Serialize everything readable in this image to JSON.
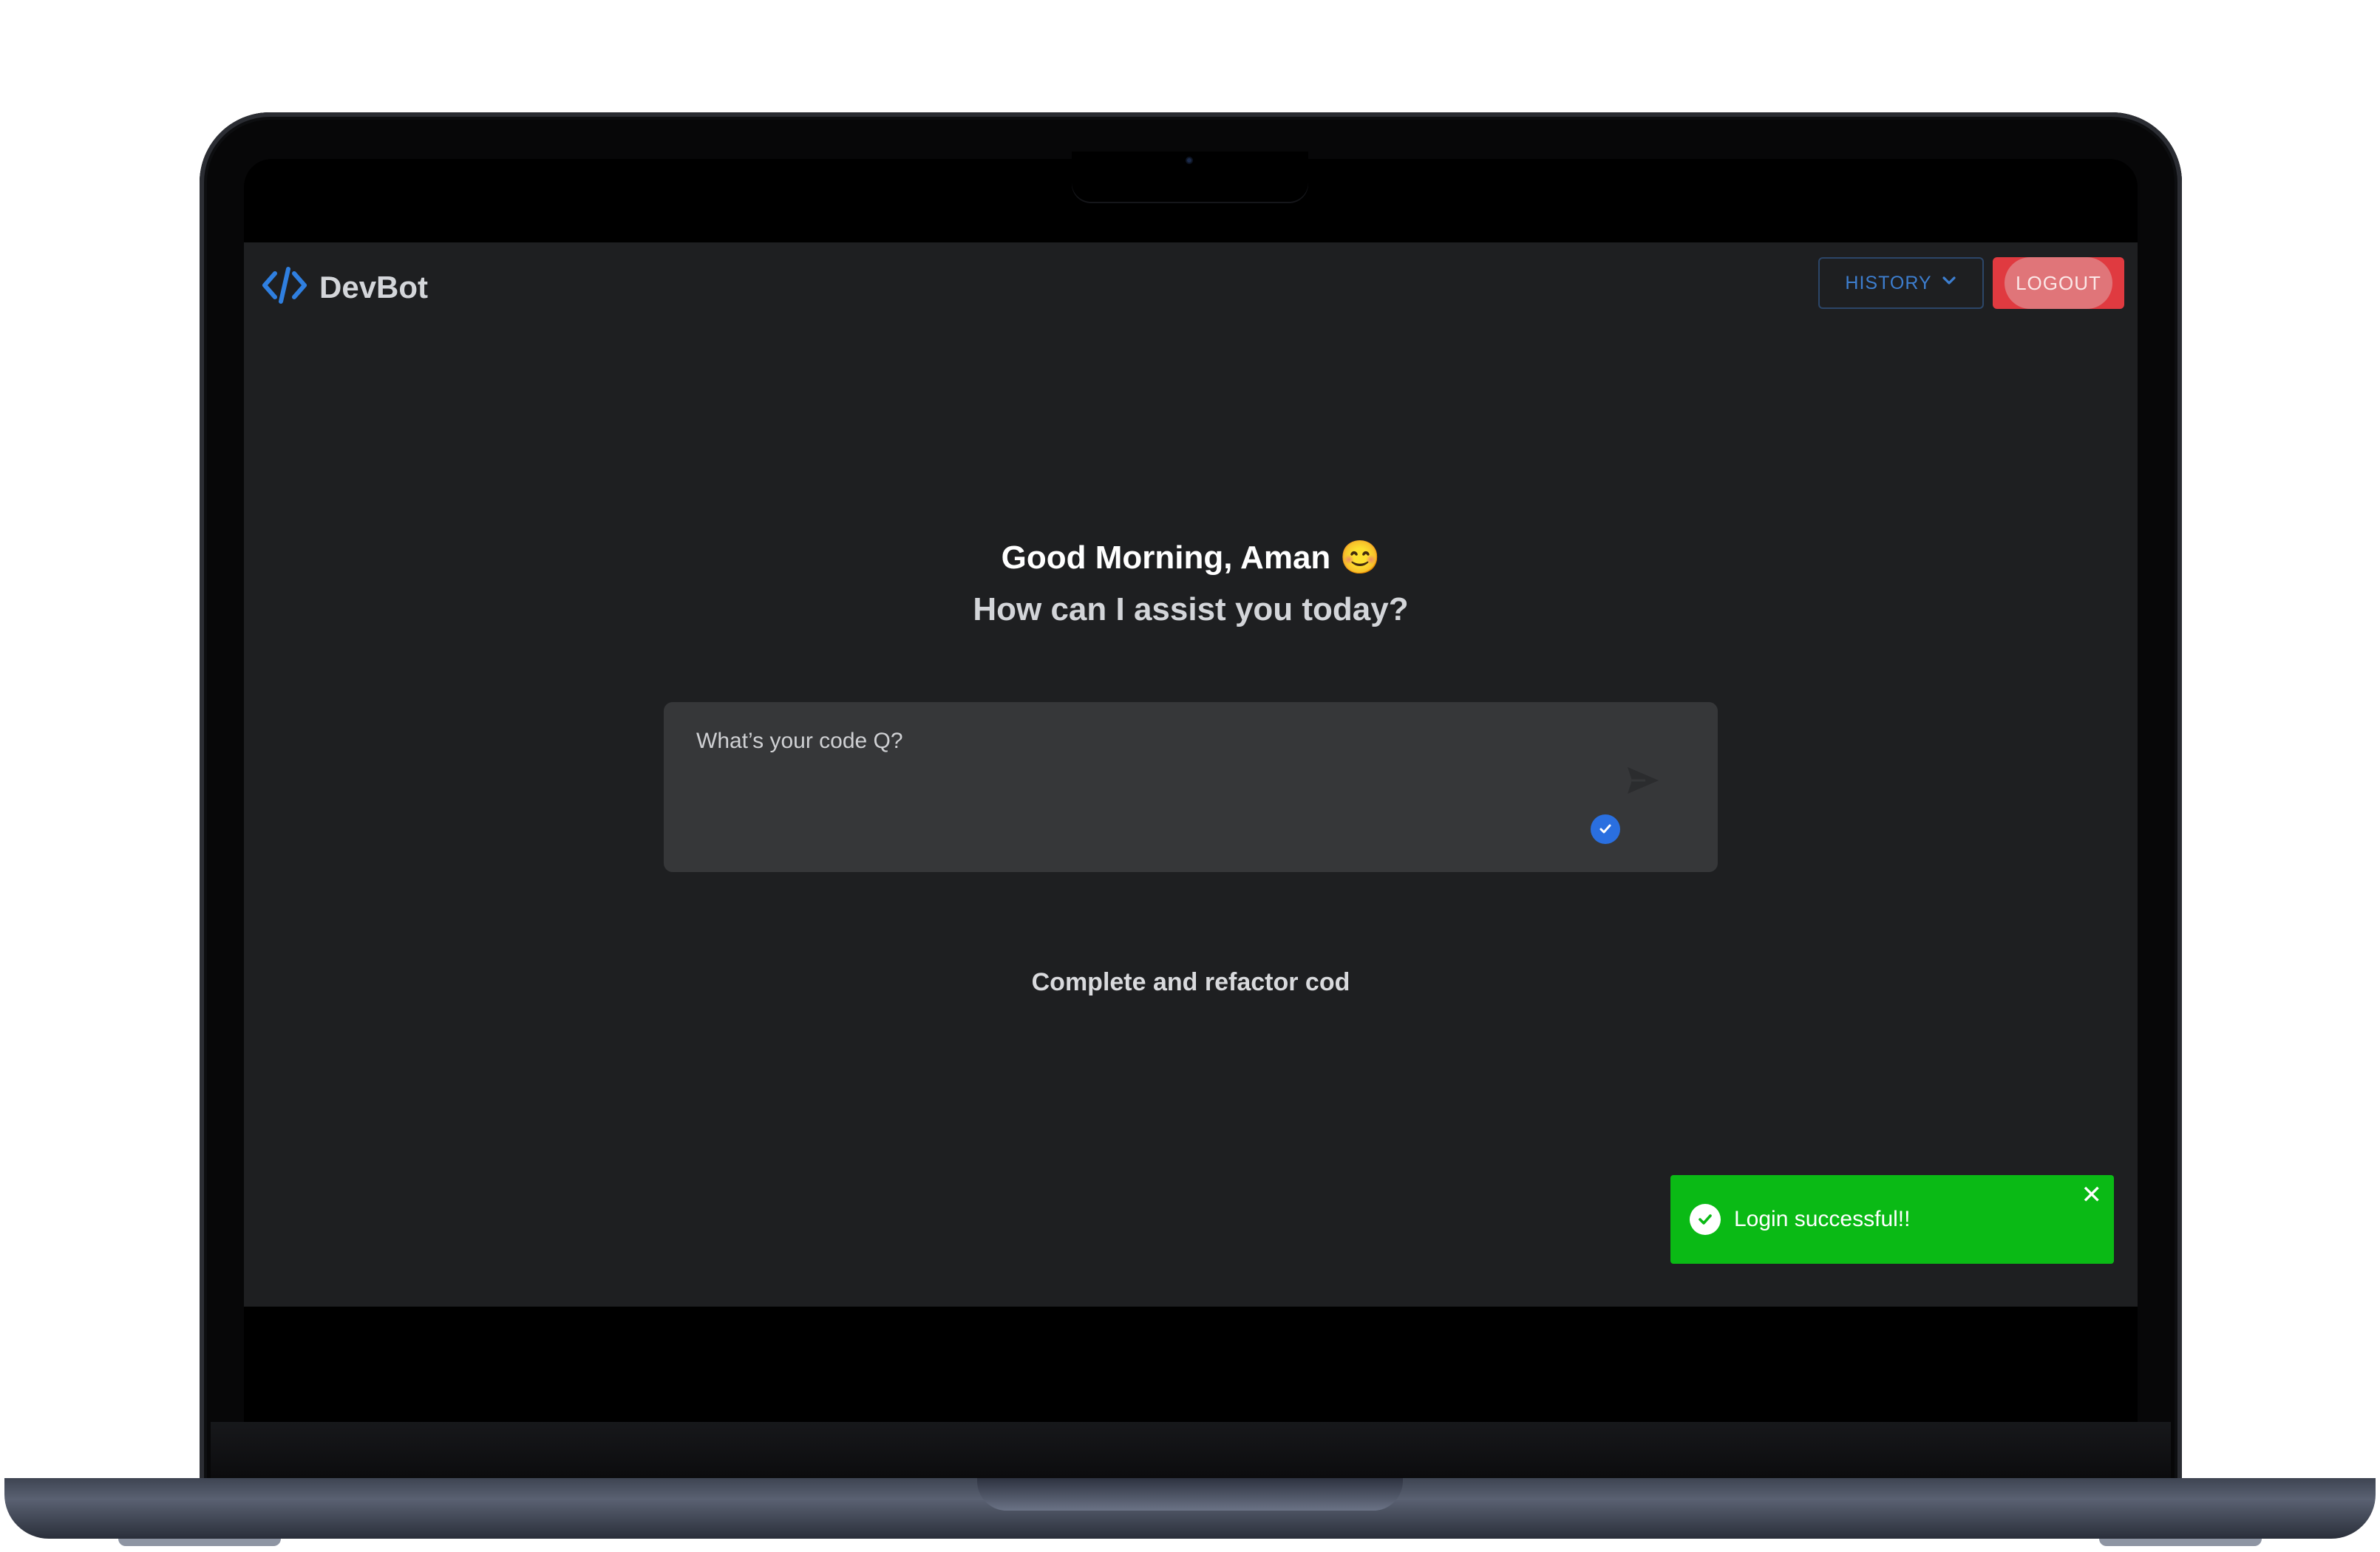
{
  "app": {
    "name": "DevBot",
    "brand_icon": "code-brackets-icon",
    "accent_color": "#3d7ecf"
  },
  "header": {
    "history_label": "HISTORY",
    "logout_label": "LOGOUT",
    "history_icon": "chevron-down-icon"
  },
  "main": {
    "greeting": "Good Morning, Aman 😊",
    "subtitle": "How can I assist you today?",
    "query": {
      "placeholder": "What’s your code Q?",
      "value": "",
      "send_icon": "send-icon",
      "status_icon": "check-circle-icon"
    },
    "suggestion": "Complete and refactor cod"
  },
  "toast": {
    "message": "Login successful!!",
    "type": "success",
    "color": "#0aba15",
    "close_symbol": "✕"
  }
}
